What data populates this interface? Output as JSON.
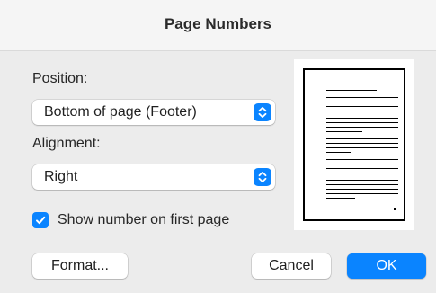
{
  "dialog": {
    "title": "Page Numbers"
  },
  "position": {
    "label": "Position:",
    "selected": "Bottom of page (Footer)"
  },
  "alignment": {
    "label": "Alignment:",
    "selected": "Right"
  },
  "first_page_option": {
    "label": "Show number on first page",
    "checked": true
  },
  "buttons": {
    "format_label": "Format...",
    "cancel_label": "Cancel",
    "ok_label": "OK"
  },
  "preview": {
    "page_number_alignment": "right",
    "page_number_position": "footer"
  },
  "colors": {
    "accent": "#0a84ff",
    "background": "#ececec"
  },
  "icons": {
    "popup": "chevron-up-down-icon",
    "checkbox": "checkmark-icon"
  }
}
